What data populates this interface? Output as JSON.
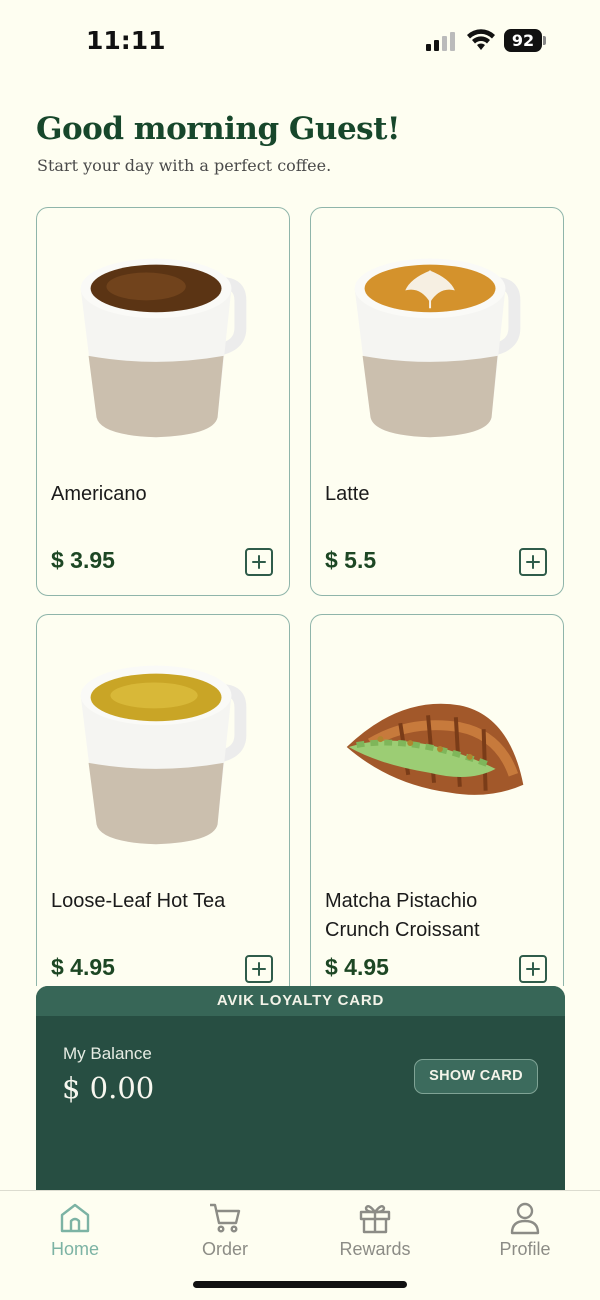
{
  "status_bar": {
    "time": "11:11",
    "battery": "92",
    "signal_icon": "cellular-signal-icon",
    "wifi_icon": "wifi-icon"
  },
  "header": {
    "greeting": "Good morning Guest!",
    "subtitle": "Start your day with a perfect coffee."
  },
  "products": [
    {
      "name": "Americano",
      "price": "$ 3.95",
      "image": "americano-cup-image",
      "add_icon": "plus-square-icon"
    },
    {
      "name": "Latte",
      "price": "$ 5.5",
      "image": "latte-cup-image",
      "add_icon": "plus-square-icon"
    },
    {
      "name": "Loose-Leaf Hot Tea",
      "price": "$ 4.95",
      "image": "tea-cup-image",
      "add_icon": "plus-square-icon"
    },
    {
      "name": "Matcha Pistachio Crunch Croissant",
      "price": "$ 4.95",
      "image": "croissant-image",
      "add_icon": "plus-square-icon"
    }
  ],
  "loyalty": {
    "title": "AVIK LOYALTY CARD",
    "balance_label": "My Balance",
    "balance_value": "$ 0.00",
    "button_label": "SHOW CARD"
  },
  "tabs": [
    {
      "label": "Home",
      "icon": "home-icon",
      "active": true
    },
    {
      "label": "Order",
      "icon": "cart-icon",
      "active": false
    },
    {
      "label": "Rewards",
      "icon": "gift-icon",
      "active": false
    },
    {
      "label": "Profile",
      "icon": "user-icon",
      "active": false
    }
  ],
  "colors": {
    "background": "#fefef1",
    "brand_green": "#17472b",
    "price_green": "#1d4724",
    "loyalty_bg": "#274e42",
    "active_tab": "#7cb3a4"
  }
}
